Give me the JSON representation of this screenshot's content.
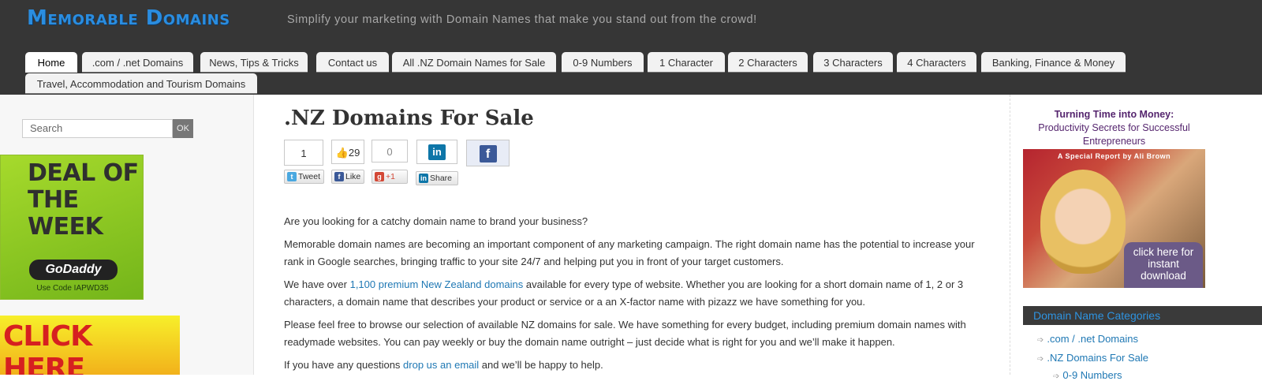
{
  "site": {
    "title": "Memorable Domains",
    "tagline": "Simplify your marketing with Domain Names that make you stand out from the crowd!"
  },
  "nav": {
    "tabs": [
      {
        "label": "Home",
        "active": true
      },
      {
        "label": ".com / .net Domains"
      },
      {
        "label": "News, Tips & Tricks"
      },
      {
        "label": "Contact us"
      },
      {
        "label": "All .NZ Domain Names for Sale"
      },
      {
        "label": "0-9 Numbers"
      },
      {
        "label": "1 Character"
      },
      {
        "label": "2 Characters"
      },
      {
        "label": "3 Characters"
      },
      {
        "label": "4 Characters"
      },
      {
        "label": "Banking, Finance & Money"
      },
      {
        "label": "Travel, Accommodation and Tourism Domains"
      }
    ]
  },
  "sidebar_left": {
    "search_placeholder": "Search",
    "search_button": "OK",
    "ad_deal": {
      "text": "DEAL OF THE WEEK",
      "brand": "GoDaddy",
      "code": "Use Code IAPWD35"
    },
    "ad_click": {
      "text": "CLICK HERE"
    }
  },
  "main": {
    "title": ".NZ Domains For Sale",
    "share": {
      "tweet_count": "1",
      "tweet_label": "Tweet",
      "like_count": "29",
      "like_label": "Like",
      "plusone_count": "0",
      "plusone_label": "+1",
      "share_label": "Share"
    },
    "p1": "Are you looking for a catchy domain name to brand your business?",
    "p2": "Memorable domain names are becoming an important component of any marketing campaign. The right domain name has the potential to increase your rank in Google searches, bringing traffic to your site 24/7 and helping put you in front of your target customers.",
    "p3_pre": "We have over ",
    "p3_link": "1,100 premium New Zealand domains",
    "p3_post": " available for every type of website. Whether you are looking for a short domain name of 1, 2 or 3 characters, a domain name that describes your product or service or a an X-factor name with pizazz we have something for you.",
    "p4": "Please feel free to browse our selection of available NZ domains for sale. We have something for every budget, including premium domain names with readymade websites. You can pay weekly or buy the domain name outright – just decide what is right for you and we’ll make it happen.",
    "p5_pre": "If you have any questions ",
    "p5_link": "drop us an email",
    "p5_post": " and we’ll be happy to help."
  },
  "sidebar_right": {
    "ad": {
      "headline": "Turning Time into Money:",
      "subline": "Productivity Secrets for Successful Entrepreneurs",
      "report": "A Special Report by Ali Brown",
      "cta": "click here for instant download"
    },
    "categories_heading": "Domain Name Categories",
    "categories": [
      ".com / .net Domains",
      ".NZ Domains For Sale",
      "0-9 Numbers"
    ]
  },
  "colors": {
    "header_bg": "#363636",
    "brand_blue": "#2a8de0",
    "link": "#1f78b4"
  }
}
